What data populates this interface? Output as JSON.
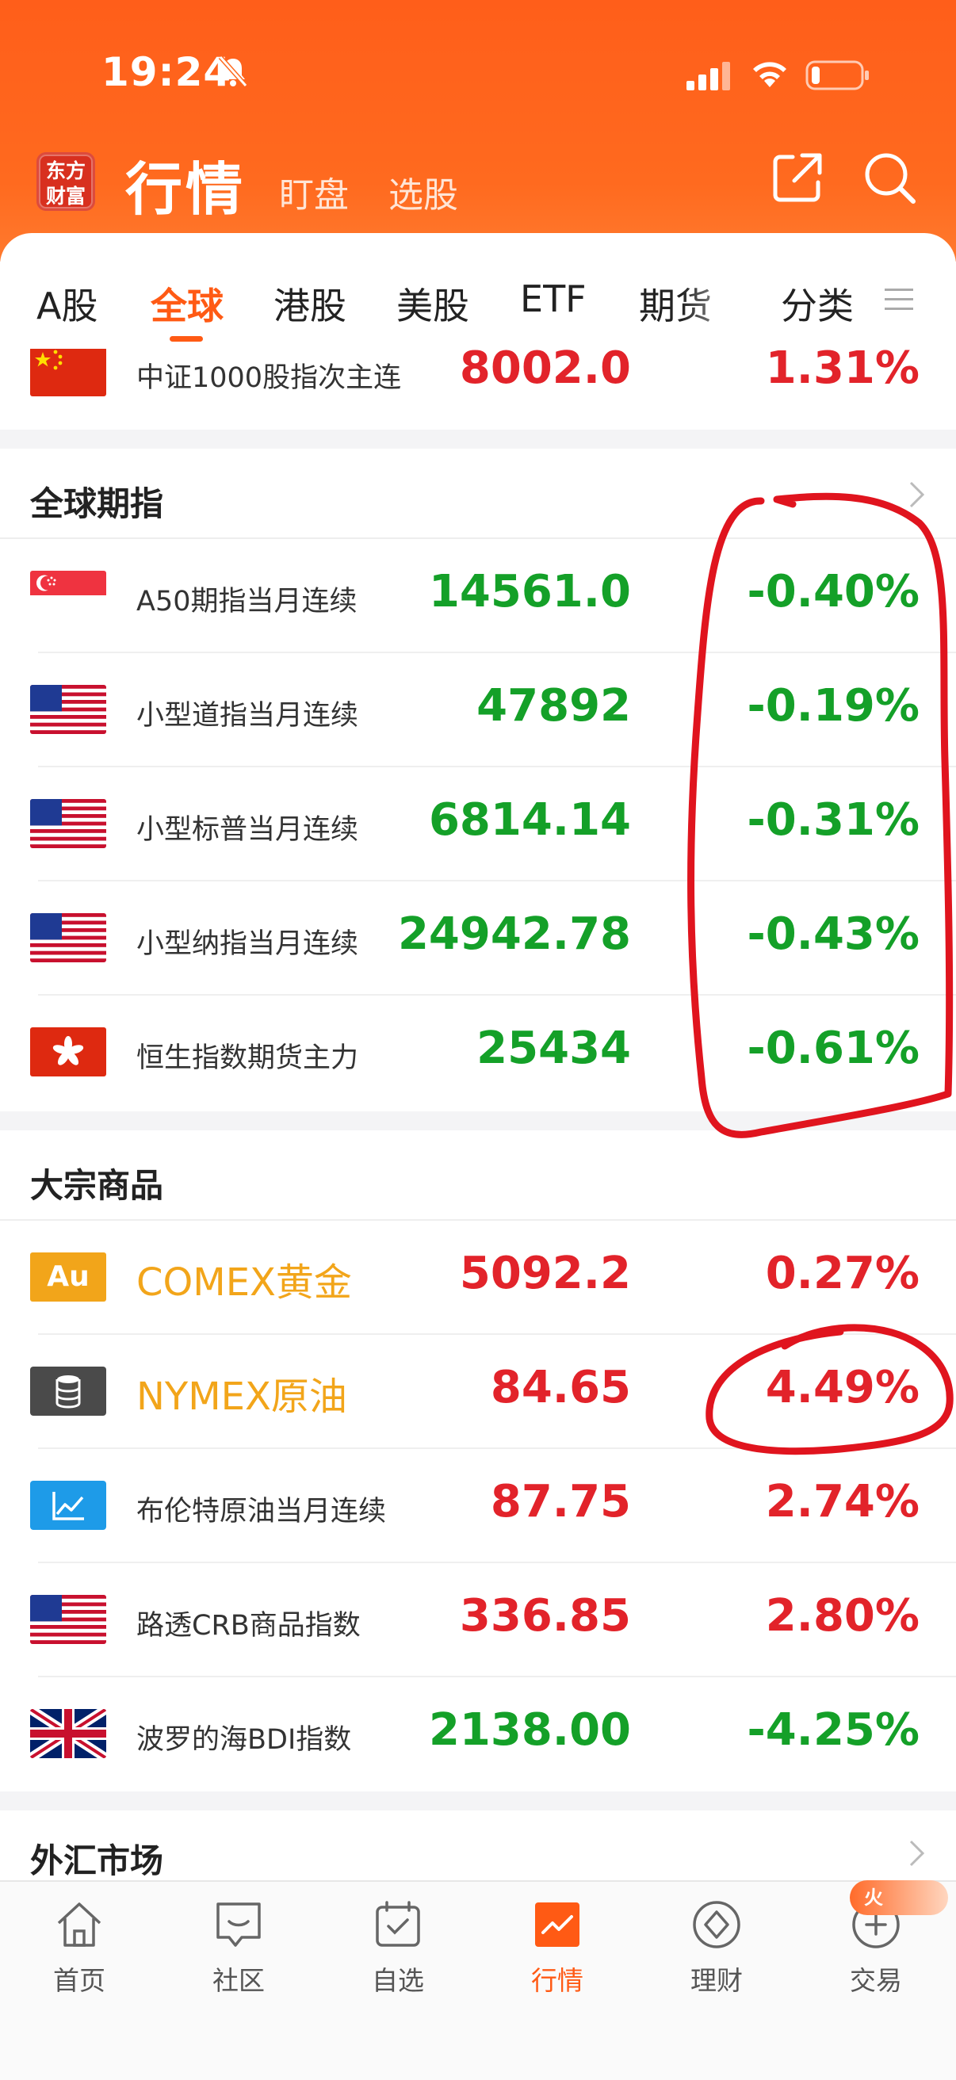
{
  "status_bar": {
    "time": "19:24"
  },
  "header": {
    "logo_line1": "东方",
    "logo_line2": "财富",
    "title": "行情",
    "sub1": "盯盘",
    "sub2": "选股"
  },
  "tabs": [
    "A股",
    "全球",
    "港股",
    "美股",
    "ETF",
    "期货",
    "分类"
  ],
  "active_tab": "全球",
  "top_row": {
    "name": "中证1000股指次主连",
    "price": "8002.0",
    "change": "1.31%",
    "flag": "china-flag"
  },
  "sections": [
    {
      "title": "全球期指",
      "rows": [
        {
          "name": "A50期指当月连续",
          "price": "14561.0",
          "change": "-0.40%",
          "flag": "singapore-flag"
        },
        {
          "name": "小型道指当月连续",
          "price": "47892",
          "change": "-0.19%",
          "flag": "us-flag"
        },
        {
          "name": "小型标普当月连续",
          "price": "6814.14",
          "change": "-0.31%",
          "flag": "us-flag"
        },
        {
          "name": "小型纳指当月连续",
          "price": "24942.78",
          "change": "-0.43%",
          "flag": "us-flag"
        },
        {
          "name": "恒生指数期货主力",
          "price": "25434",
          "change": "-0.61%",
          "flag": "hong-kong-flag"
        }
      ]
    },
    {
      "title": "大宗商品",
      "rows": [
        {
          "name": "COMEX黄金",
          "price": "5092.2",
          "change": "0.27%",
          "flag": "gold-icon",
          "badge": "Au"
        },
        {
          "name": "NYMEX原油",
          "price": "84.65",
          "change": "4.49%",
          "flag": "oil-barrel-icon"
        },
        {
          "name": "布伦特原油当月连续",
          "price": "87.75",
          "change": "2.74%",
          "flag": "chart-trend-icon"
        },
        {
          "name": "路透CRB商品指数",
          "price": "336.85",
          "change": "2.80%",
          "flag": "us-flag"
        },
        {
          "name": "波罗的海BDI指数",
          "price": "2138.00",
          "change": "-4.25%",
          "flag": "uk-flag"
        }
      ]
    },
    {
      "title": "外汇市场"
    }
  ],
  "bottom_nav": [
    {
      "label": "首页",
      "icon": "home-icon"
    },
    {
      "label": "社区",
      "icon": "community-icon"
    },
    {
      "label": "自选",
      "icon": "watchlist-icon"
    },
    {
      "label": "行情",
      "icon": "market-icon"
    },
    {
      "label": "理财",
      "icon": "wealth-icon"
    },
    {
      "label": "交易",
      "icon": "trade-icon"
    }
  ],
  "hot_badge": "火",
  "colors": {
    "accent": "#ff5a14",
    "up": "#e2232a",
    "down": "#14a028",
    "annotation": "#e0141e"
  }
}
